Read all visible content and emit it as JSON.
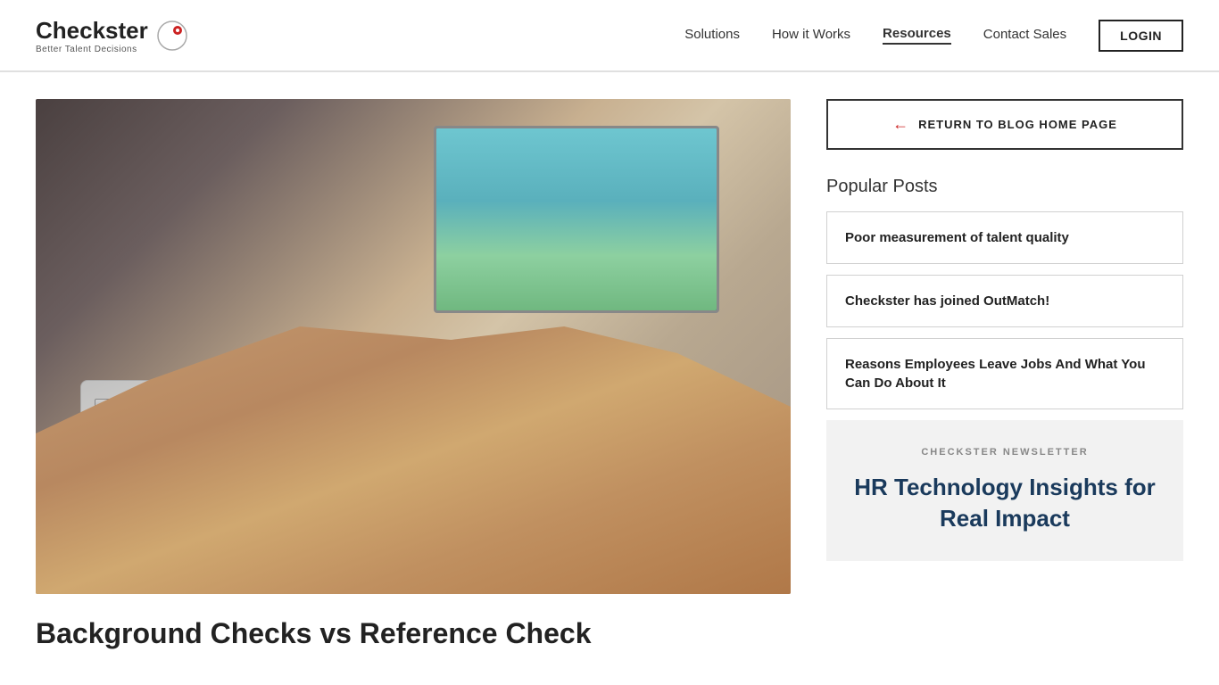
{
  "header": {
    "logo_name": "Checkster",
    "logo_tagline": "Better Talent Decisions",
    "nav_items": [
      {
        "label": "Solutions",
        "active": false
      },
      {
        "label": "How it Works",
        "active": false
      },
      {
        "label": "Resources",
        "active": true
      },
      {
        "label": "Contact Sales",
        "active": false
      }
    ],
    "login_label": "LOGIN"
  },
  "sidebar": {
    "return_btn_label": "RETURN TO BLOG HOME PAGE",
    "popular_posts_label": "Popular Posts",
    "posts": [
      {
        "title": "Poor measurement of talent quality"
      },
      {
        "title": "Checkster has joined OutMatch!"
      },
      {
        "title": "Reasons Employees Leave Jobs And What You Can Do About It"
      }
    ],
    "newsletter": {
      "label": "CHECKSTER NEWSLETTER",
      "title": "HR Technology Insights for Real Impact"
    }
  },
  "article": {
    "title": "Background Checks vs Reference Check"
  }
}
